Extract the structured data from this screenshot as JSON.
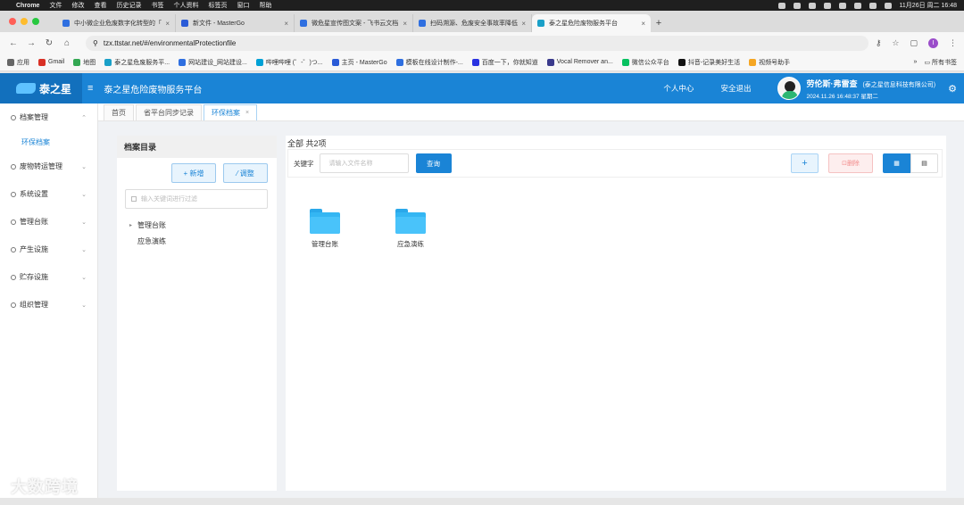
{
  "colors": {
    "accent": "#1a84d6",
    "danger_light": "#fdeeee",
    "folder": "#34b6f3"
  },
  "macbar": {
    "app": "Chrome",
    "menus": [
      "文件",
      "修改",
      "查看",
      "历史记录",
      "书签",
      "个人资料",
      "标签页",
      "窗口",
      "帮助"
    ],
    "clock": "11月26日 周二  16:48"
  },
  "browser_tabs": [
    {
      "title": "中小微企业危废数字化转型的「",
      "color": "#2f6fe0"
    },
    {
      "title": "新文件 - MasterGo",
      "color": "#2a5bd7"
    },
    {
      "title": "微危星宣传图文案 - 飞书云文档",
      "color": "#2f6fe0"
    },
    {
      "title": "扫码溯源、危废安全事故率降低",
      "color": "#2f6fe0"
    },
    {
      "title": "泰之星危险废物服务平台",
      "color": "#1aa0c8"
    }
  ],
  "address": {
    "url": "tzx.ttstar.net/#/environmentalProtectionfile"
  },
  "bookmarks": [
    {
      "label": "应用",
      "color": "#666"
    },
    {
      "label": "Gmail",
      "color": "#d93025"
    },
    {
      "label": "地图",
      "color": "#34a853"
    },
    {
      "label": "泰之星危废服务平...",
      "color": "#1aa0c8"
    },
    {
      "label": "网站建设_网站建设...",
      "color": "#2f6fe0"
    },
    {
      "label": "哔哩哔哩 (゜-゜)つ...",
      "color": "#00a1d6"
    },
    {
      "label": "主页 - MasterGo",
      "color": "#2a5bd7"
    },
    {
      "label": "模板在线设计制作-...",
      "color": "#2f6fe0"
    },
    {
      "label": "百度一下，你就知道",
      "color": "#2932e1"
    },
    {
      "label": "Vocal Remover an...",
      "color": "#3a3a8c"
    },
    {
      "label": "微信公众平台",
      "color": "#07c160"
    },
    {
      "label": "抖音-记录美好生活",
      "color": "#111"
    },
    {
      "label": "视频号助手",
      "color": "#f5a623"
    }
  ],
  "bookmarks_all": "所有书签",
  "app": {
    "logo": "泰之星",
    "title": "泰之星危险废物服务平台",
    "personal_center": "个人中心",
    "logout": "安全退出",
    "user_name": "劳伦斯·弗雷查",
    "company": "(泰之星信息科技有限公司)",
    "datetime": "2024.11.26 16:48:37 星期二"
  },
  "sidebar": {
    "items": [
      {
        "label": "档案管理"
      },
      {
        "label": "废物转运管理"
      },
      {
        "label": "系统设置"
      },
      {
        "label": "管理台账"
      },
      {
        "label": "产生设施"
      },
      {
        "label": "贮存设施"
      },
      {
        "label": "组织管理"
      }
    ],
    "sub_active": "环保档案"
  },
  "app_tabs": [
    {
      "label": "首页"
    },
    {
      "label": "省平台同步记录"
    },
    {
      "label": "环保档案"
    }
  ],
  "directory": {
    "title": "档案目录",
    "add_label": "+ 新增",
    "adjust_label": "⁄ 调整",
    "filter_placeholder": "输入关键词进行过滤",
    "tree": [
      "管理台账",
      "应急演练"
    ]
  },
  "main": {
    "count_text": "全部 共2项",
    "keyword_label": "关键字",
    "keyword_placeholder": "请输入文件名称",
    "query_label": "查询",
    "add_icon": "+",
    "delete_label": "删除",
    "folders": [
      "管理台账",
      "应急演练"
    ]
  },
  "watermark": "大数跨境"
}
